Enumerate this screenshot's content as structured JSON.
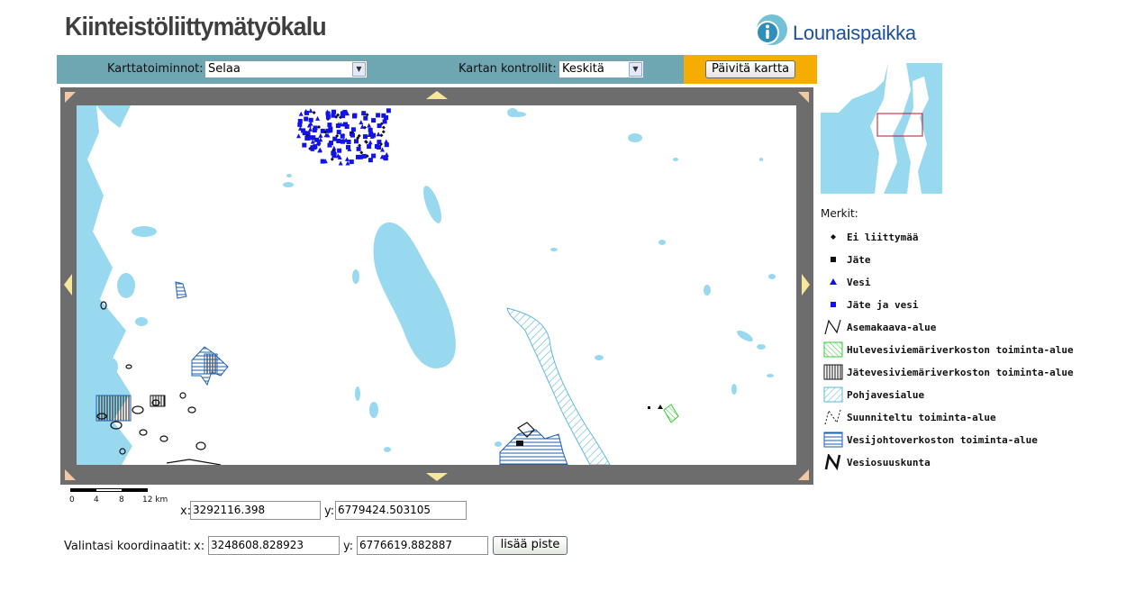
{
  "header": {
    "title": "Kiinteistöliittymätyökalu",
    "logo_text": "Lounaispaikka"
  },
  "toolbar": {
    "map_actions_label": "Karttatoiminnot:",
    "map_actions_value": "Selaa",
    "map_controls_label": "Kartan kontrollit:",
    "map_controls_value": "Keskitä",
    "refresh_button": "Päivitä kartta"
  },
  "legend": {
    "title": "Merkit:",
    "items": [
      {
        "label": "Ei liittymää",
        "icon": "black-diamond-icon"
      },
      {
        "label": "Jäte",
        "icon": "black-square-icon"
      },
      {
        "label": "Vesi",
        "icon": "blue-triangle-icon"
      },
      {
        "label": "Jäte ja vesi",
        "icon": "blue-square-icon"
      },
      {
        "label": "Asemakaava-alue",
        "icon": "thin-n-outline-icon"
      },
      {
        "label": "Hulevesiviemäriverkoston toiminta-alue",
        "icon": "green-hatch-icon"
      },
      {
        "label": "Jätevesiviemäriverkoston toiminta-alue",
        "icon": "black-vertical-hatch-icon"
      },
      {
        "label": "Pohjavesialue",
        "icon": "blue-diagonal-hatch-icon"
      },
      {
        "label": "Suunniteltu toiminta-alue",
        "icon": "dashed-n-outline-icon"
      },
      {
        "label": "Vesijohtoverkoston toiminta-alue",
        "icon": "blue-horizontal-hatch-icon"
      },
      {
        "label": "Vesiosuuskunta",
        "icon": "bold-n-outline-icon"
      }
    ]
  },
  "scalebar": {
    "ticks": [
      "0",
      "4",
      "8",
      "12 km"
    ]
  },
  "cursor_coords": {
    "x_label": "x:",
    "x_value": "3292116.398",
    "y_label": "y:",
    "y_value": "6779424.503105"
  },
  "selection": {
    "label": "Valintasi koordinaatit:",
    "x_label": "x:",
    "x_value": "3248608.828923",
    "y_label": "y:",
    "y_value": "6776619.882887",
    "add_button": "lisää piste"
  },
  "colors": {
    "water": "#99d9ef",
    "toolbar": "#6ea7b2",
    "refresh_area": "#f6ad02",
    "frame": "#6d6d6d",
    "pan_arrow": "#f7e79b",
    "corner": "#f2c9a2",
    "points_blue": "#1313e8",
    "hatch_blue": "#1a5fb4",
    "hatch_green": "#33cc33",
    "logo_blue": "#1d4f9a"
  }
}
